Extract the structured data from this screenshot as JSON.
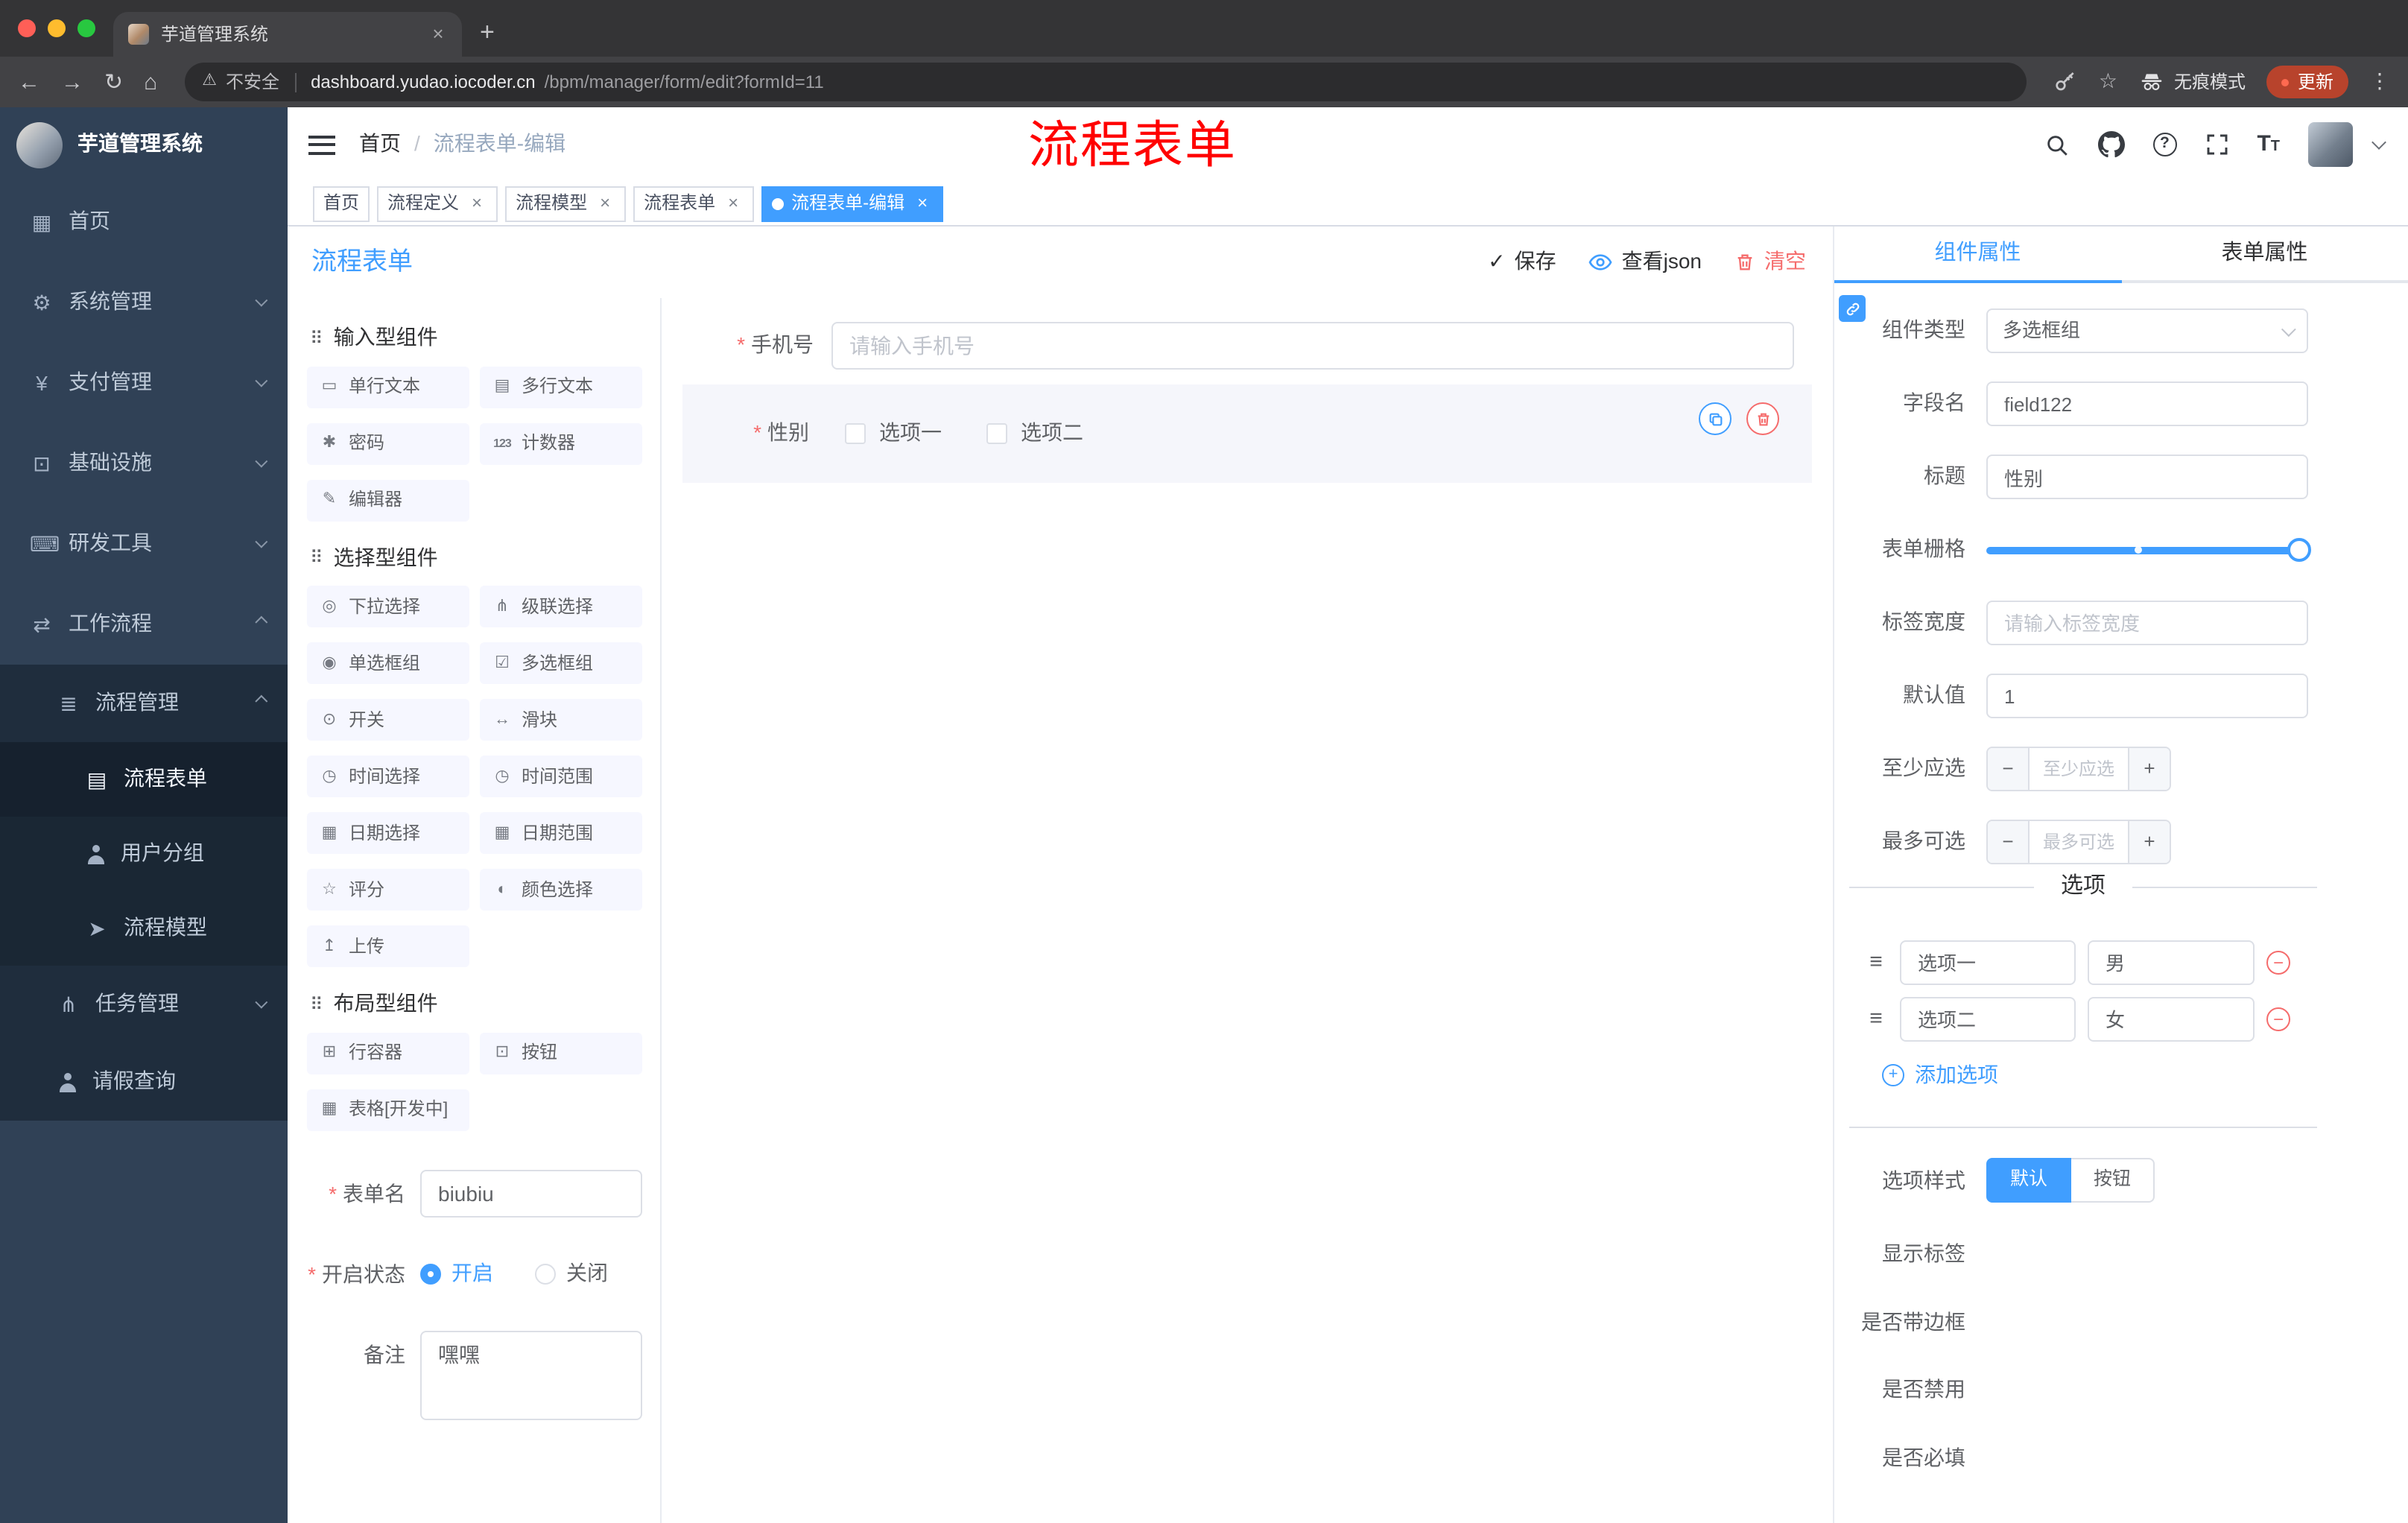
{
  "theme": {
    "accent": "#409eff",
    "danger": "#f56c6c",
    "sidebar_bg": "#304156"
  },
  "browser": {
    "tab_title": "芋道管理系统",
    "security_label": "不安全",
    "url_host": "dashboard.yudao.iocoder.cn",
    "url_path": "/bpm/manager/form/edit?formId=11",
    "incognito_label": "无痕模式",
    "update_label": "更新"
  },
  "sidebar": {
    "logo_title": "芋道管理系统",
    "home": "首页",
    "system": "系统管理",
    "payment": "支付管理",
    "infra": "基础设施",
    "devtools": "研发工具",
    "workflow": "工作流程",
    "process_management": "流程管理",
    "process_form": "流程表单",
    "user_group": "用户分组",
    "process_model": "流程模型",
    "task_management": "任务管理",
    "leave_query": "请假查询"
  },
  "header": {
    "breadcrumb_home": "首页",
    "breadcrumb_sep": "/",
    "breadcrumb_current": "流程表单-编辑",
    "annotation": "流程表单"
  },
  "tags": [
    {
      "label": "首页",
      "active": false,
      "closable": false
    },
    {
      "label": "流程定义",
      "active": false,
      "closable": true
    },
    {
      "label": "流程模型",
      "active": false,
      "closable": true
    },
    {
      "label": "流程表单",
      "active": false,
      "closable": true
    },
    {
      "label": "流程表单-编辑",
      "active": true,
      "closable": true
    }
  ],
  "designer": {
    "title": "流程表单",
    "save": "保存",
    "view_json": "查看json",
    "clear": "清空",
    "palette": {
      "sections": [
        {
          "title": "输入型组件",
          "items": [
            {
              "label": "单行文本",
              "icon": "single-line-text-icon"
            },
            {
              "label": "多行文本",
              "icon": "multi-line-text-icon"
            },
            {
              "label": "密码",
              "icon": "password-icon"
            },
            {
              "label": "计数器",
              "icon": "counter-icon"
            },
            {
              "label": "编辑器",
              "icon": "editor-icon"
            }
          ]
        },
        {
          "title": "选择型组件",
          "items": [
            {
              "label": "下拉选择",
              "icon": "select-icon"
            },
            {
              "label": "级联选择",
              "icon": "cascader-icon"
            },
            {
              "label": "单选框组",
              "icon": "radio-group-icon"
            },
            {
              "label": "多选框组",
              "icon": "checkbox-group-icon"
            },
            {
              "label": "开关",
              "icon": "switch-icon"
            },
            {
              "label": "滑块",
              "icon": "slider-icon"
            },
            {
              "label": "时间选择",
              "icon": "time-picker-icon"
            },
            {
              "label": "时间范围",
              "icon": "time-range-icon"
            },
            {
              "label": "日期选择",
              "icon": "date-picker-icon"
            },
            {
              "label": "日期范围",
              "icon": "date-range-icon"
            },
            {
              "label": "评分",
              "icon": "rate-icon"
            },
            {
              "label": "颜色选择",
              "icon": "color-picker-icon"
            },
            {
              "label": "上传",
              "icon": "upload-icon"
            }
          ]
        },
        {
          "title": "布局型组件",
          "items": [
            {
              "label": "行容器",
              "icon": "row-container-icon"
            },
            {
              "label": "按钮",
              "icon": "button-icon"
            },
            {
              "label": "表格[开发中]",
              "icon": "table-icon"
            }
          ]
        }
      ]
    },
    "canvas": {
      "phone": {
        "label": "手机号",
        "required": true,
        "placeholder": "请输入手机号"
      },
      "gender": {
        "label": "性别",
        "required": true,
        "option1": "选项一",
        "option2": "选项二",
        "selected": true
      }
    },
    "meta": {
      "form_name_label": "表单名",
      "form_name_value": "biubiu",
      "status_label": "开启状态",
      "status_on": "开启",
      "status_off": "关闭",
      "status_selected": "开启",
      "remark_label": "备注",
      "remark_value": "嘿嘿"
    }
  },
  "props": {
    "tab_component": "组件属性",
    "tab_form": "表单属性",
    "component_type_label": "组件类型",
    "component_type_value": "多选框组",
    "field_name_label": "字段名",
    "field_name_value": "field122",
    "title_label": "标题",
    "title_value": "性别",
    "grid_label": "表单栅格",
    "grid_percent": 100,
    "grid_mark_percent": 47,
    "label_width_label": "标签宽度",
    "label_width_placeholder": "请输入标签宽度",
    "default_label": "默认值",
    "default_value": "1",
    "min_label": "至少应选",
    "min_placeholder": "至少应选",
    "max_label": "最多可选",
    "max_placeholder": "最多可选",
    "options_title": "选项",
    "options": [
      {
        "name": "选项一",
        "value": "男"
      },
      {
        "name": "选项二",
        "value": "女"
      }
    ],
    "add_option": "添加选项",
    "style_label": "选项样式",
    "style_default": "默认",
    "style_button": "按钮",
    "switches": [
      {
        "label": "显示标签",
        "on": true
      },
      {
        "label": "是否带边框",
        "on": false
      },
      {
        "label": "是否禁用",
        "on": false
      },
      {
        "label": "是否必填",
        "on": true
      }
    ]
  }
}
